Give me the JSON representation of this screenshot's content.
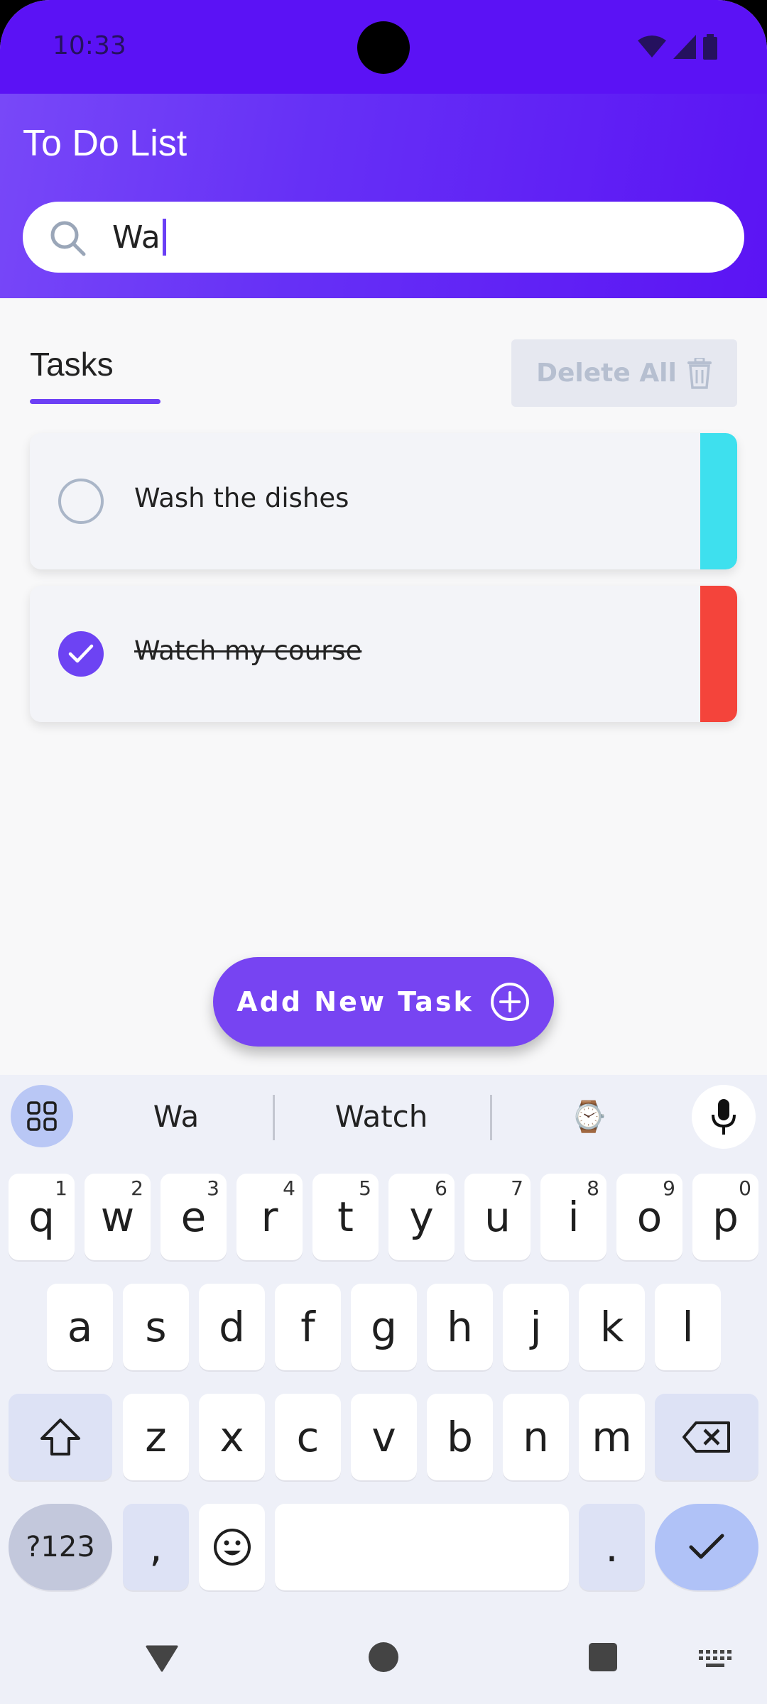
{
  "status_bar": {
    "time": "10:33"
  },
  "app": {
    "title": "To Do List"
  },
  "search": {
    "value": "Wa"
  },
  "tasks_section": {
    "tab_label": "Tasks",
    "delete_all_label": "Delete All"
  },
  "tasks": [
    {
      "label": "Wash the dishes",
      "completed": false,
      "color": "#3ee0ee"
    },
    {
      "label": "Watch my course",
      "completed": true,
      "color": "#f4443b"
    }
  ],
  "add_button": {
    "label": "Add New Task"
  },
  "keyboard": {
    "suggestions": [
      "Wa",
      "Watch",
      "⌚"
    ],
    "row1": [
      {
        "k": "q",
        "h": "1"
      },
      {
        "k": "w",
        "h": "2"
      },
      {
        "k": "e",
        "h": "3"
      },
      {
        "k": "r",
        "h": "4"
      },
      {
        "k": "t",
        "h": "5"
      },
      {
        "k": "y",
        "h": "6"
      },
      {
        "k": "u",
        "h": "7"
      },
      {
        "k": "i",
        "h": "8"
      },
      {
        "k": "o",
        "h": "9"
      },
      {
        "k": "p",
        "h": "0"
      }
    ],
    "row2": [
      "a",
      "s",
      "d",
      "f",
      "g",
      "h",
      "j",
      "k",
      "l"
    ],
    "row3": [
      "z",
      "x",
      "c",
      "v",
      "b",
      "n",
      "m"
    ],
    "symbols_label": "?123",
    "comma": ",",
    "period": "."
  },
  "colors": {
    "accent": "#6d40f5",
    "header": "#5b14f4"
  }
}
